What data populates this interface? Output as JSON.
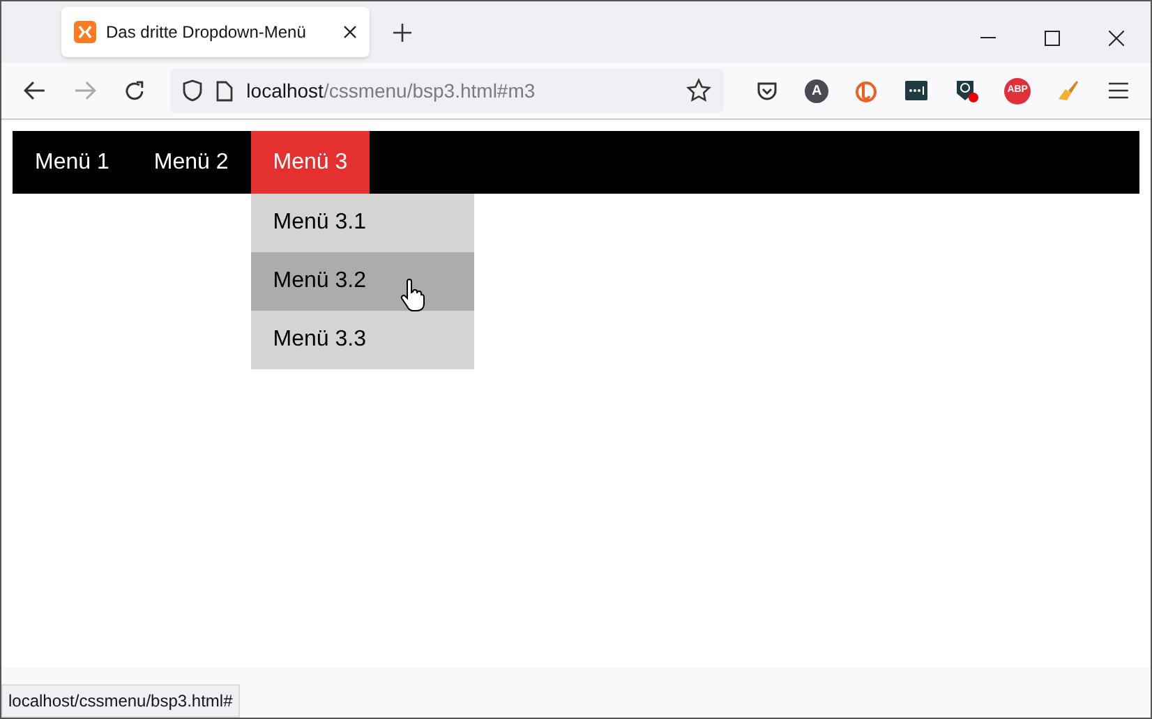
{
  "browser_tab": {
    "title": "Das dritte Dropdown-Menü",
    "selected": true
  },
  "address_bar": {
    "host": "localhost",
    "path": "/cssmenu/bsp3.html#m3"
  },
  "extensions": [
    {
      "kind": "pocket"
    },
    {
      "kind": "letter",
      "label": "A"
    },
    {
      "kind": "bitly"
    },
    {
      "kind": "dots"
    },
    {
      "kind": "badge-dot"
    },
    {
      "kind": "abp",
      "label": "ABP"
    },
    {
      "kind": "brush"
    }
  ],
  "nav_menu": [
    {
      "label": "Menü 1",
      "selected": false
    },
    {
      "label": "Menü 2",
      "selected": false
    },
    {
      "label": "Menü 3",
      "selected": true,
      "submenu": [
        {
          "label": "Menü 3.1",
          "selected": false
        },
        {
          "label": "Menü 3.2",
          "selected": true
        },
        {
          "label": "Menü 3.3",
          "selected": false
        }
      ]
    }
  ],
  "status_bar": "localhost/cssmenu/bsp3.html#"
}
